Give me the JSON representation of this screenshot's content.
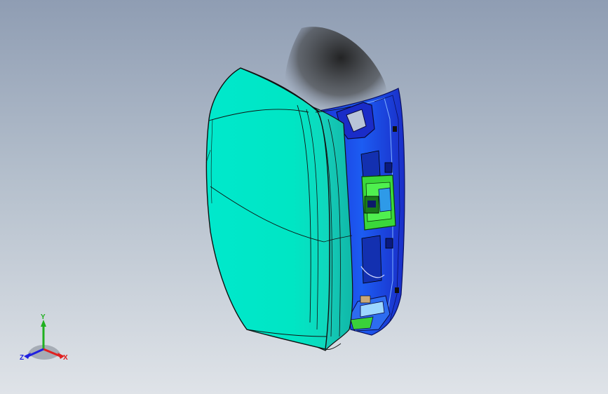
{
  "viewport": {
    "background_top": "#8f9db3",
    "background_bottom": "#dfe3e8",
    "model": {
      "body_color": "#00e8c8",
      "frame_color": "#1a3cf0",
      "bracket_color": "#34d33a",
      "edge_color": "#111111",
      "shadow_color": "#2a2a2a"
    }
  },
  "triad": {
    "x_label": "X",
    "y_label": "Y",
    "z_label": "Z",
    "x_color": "#e02020",
    "y_color": "#20b020",
    "z_color": "#2020e0"
  }
}
